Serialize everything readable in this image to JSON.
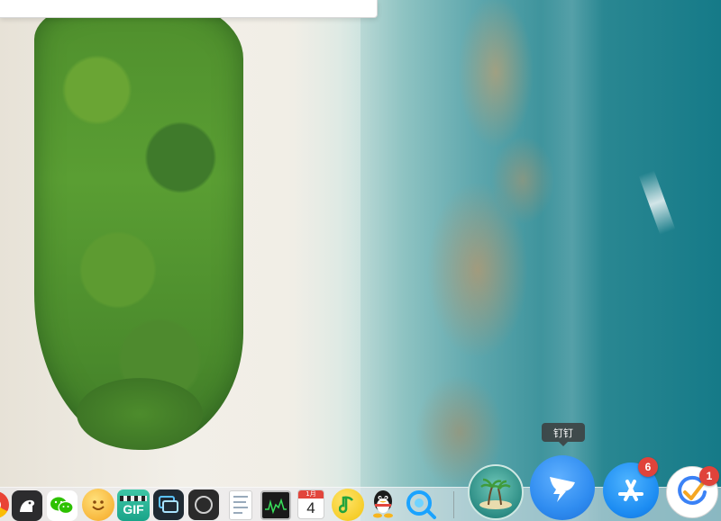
{
  "tooltip": {
    "text": "钉钉"
  },
  "dock": {
    "items": [
      {
        "name": "chrome-app",
        "icon": "chrome-icon"
      },
      {
        "name": "bear-app",
        "icon": "dog-icon"
      },
      {
        "name": "wechat-app",
        "icon": "wechat-icon"
      },
      {
        "name": "emoji-app",
        "icon": "smile-icon"
      },
      {
        "name": "gif-app",
        "icon": "gif-icon",
        "label": "GIF"
      },
      {
        "name": "window-app",
        "icon": "window-icon"
      },
      {
        "name": "circle-app",
        "icon": "circle-icon"
      },
      {
        "name": "notes-app",
        "icon": "notes-icon"
      },
      {
        "name": "activity-monitor-app",
        "icon": "monitor-icon"
      },
      {
        "name": "calendar-app",
        "icon": "calendar-icon",
        "label": "4",
        "month": "1月"
      },
      {
        "name": "qq-music-app",
        "icon": "music-note-icon"
      },
      {
        "name": "qq-app",
        "icon": "penguin-icon"
      },
      {
        "name": "browser-app",
        "icon": "chat-bubble-icon"
      },
      {
        "name": "island-app",
        "icon": "palm-tree-icon"
      },
      {
        "name": "dingtalk-app",
        "icon": "dingtalk-icon"
      },
      {
        "name": "app-store-app",
        "icon": "app-store-icon",
        "badge": "6"
      },
      {
        "name": "check-app",
        "icon": "check-icon",
        "badge": "1"
      }
    ]
  },
  "colors": {
    "dingtalk": "#3296fa",
    "appstore": "#1c8cf2",
    "badge": "#e0433b",
    "wechat": "#2dc100",
    "qqmusic": "#f7d21f"
  }
}
